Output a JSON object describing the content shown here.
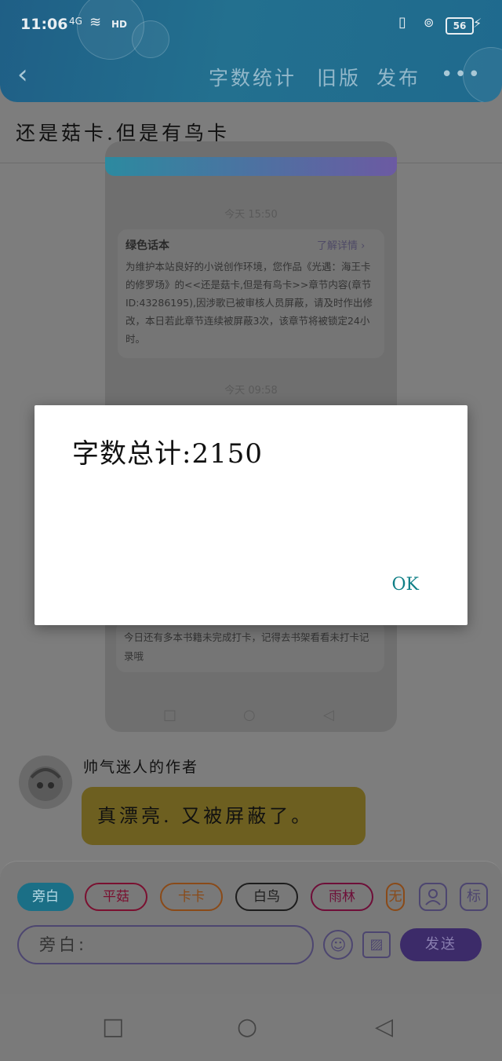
{
  "status_bar": {
    "time": "11:06",
    "network": "4G",
    "hd": "HD",
    "battery": "56"
  },
  "nav": {
    "back": "‹",
    "word_count": "字数统计",
    "old_version": "旧版",
    "publish": "发布",
    "more": "•••"
  },
  "chapter_title": "还是菇卡.但是有鸟卡",
  "screenshot": {
    "timestamp1": "今天 15:50",
    "notice_title": "绿色话本",
    "notice_more": "了解详情 ›",
    "notice_body": "为维护本站良好的小说创作环境，您作品《光遇：海王卡的修罗场》的<<还是菇卡,但是有鸟卡>>章节内容(章节ID:43286195),因涉歌已被审核人员屏蔽，请及时作出修改，本日若此章节连续被屏蔽3次，该章节将被锁定24小时。",
    "timestamp2": "今天 09:58",
    "notice2_text": "今日还有多本书籍未完成打卡，记得去书架看看未打卡记录哦"
  },
  "message": {
    "author": "帅气迷人的作者",
    "text": "真漂亮. 又被屏蔽了。"
  },
  "composer": {
    "roles": [
      "旁白",
      "平菇",
      "卡卡",
      "白鸟",
      "雨林",
      "无"
    ],
    "role_colors": [
      "#1b6f86",
      "#a3123d",
      "#a8571c",
      "#222222",
      "#8a1146",
      "#a8571c"
    ],
    "input_label": "旁白:",
    "person_icon": "user-icon",
    "tag_label": "标",
    "emoji": "☺",
    "image": "▨",
    "send": "发送"
  },
  "dialog": {
    "text": "字数总计:2150",
    "ok": "OK"
  }
}
